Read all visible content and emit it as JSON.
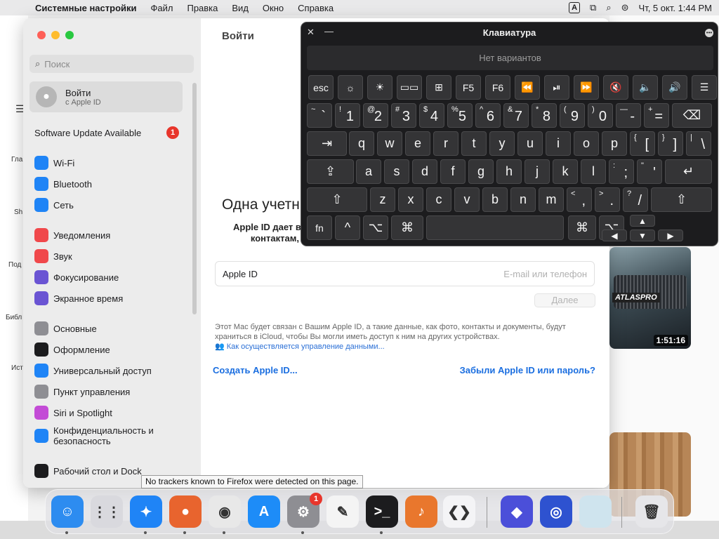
{
  "menubar": {
    "app_name": "Системные настройки",
    "items": [
      "Файл",
      "Правка",
      "Вид",
      "Окно",
      "Справка"
    ],
    "input_source": "A",
    "clock": "Чт, 5 окт.  1:44 PM"
  },
  "background": {
    "sidebar_texts": [
      "Гла",
      "Sh",
      "Под",
      "Библ",
      "Ист"
    ],
    "video_duration": "1:51:16",
    "video_plate": "ATLASPRO"
  },
  "settings": {
    "search_placeholder": "Поиск",
    "account_name": "Войти",
    "account_sub": "с Apple ID",
    "update_label": "Software Update Available",
    "update_count": "1",
    "items": [
      {
        "label": "Wi-Fi",
        "color": "#1f84f6",
        "icon": "wifi-icon"
      },
      {
        "label": "Bluetooth",
        "color": "#1f84f6",
        "icon": "bluetooth-icon"
      },
      {
        "label": "Сеть",
        "color": "#1f84f6",
        "icon": "globe-icon"
      },
      {
        "label": "Уведомления",
        "color": "#f0484b",
        "icon": "bell-icon"
      },
      {
        "label": "Звук",
        "color": "#f0484b",
        "icon": "speaker-icon"
      },
      {
        "label": "Фокусирование",
        "color": "#6a54d3",
        "icon": "moon-icon"
      },
      {
        "label": "Экранное время",
        "color": "#6a54d3",
        "icon": "hourglass-icon"
      },
      {
        "label": "Основные",
        "color": "#8e8e93",
        "icon": "gear-icon"
      },
      {
        "label": "Оформление",
        "color": "#1c1c1e",
        "icon": "appearance-icon"
      },
      {
        "label": "Универсальный доступ",
        "color": "#1f84f6",
        "icon": "accessibility-icon"
      },
      {
        "label": "Пункт управления",
        "color": "#8e8e93",
        "icon": "control-center-icon"
      },
      {
        "label": "Siri и Spotlight",
        "color": "#c34bd6",
        "icon": "siri-icon"
      },
      {
        "label": "Конфиденциальность и",
        "label2": "безопасность",
        "color": "#1f84f6",
        "icon": "hand-icon"
      },
      {
        "label": "Рабочий стол и Dock",
        "color": "#1c1c1e",
        "icon": "dock-icon"
      }
    ],
    "content": {
      "title": "Войти",
      "heading": "Одна учетн",
      "desc_line1": "Apple ID дает в",
      "desc_line2": "контактам,",
      "field_label": "Apple ID",
      "field_placeholder": "E-mail или телефон",
      "next_button": "Далее",
      "info_text": "Этот Mac будет связан с Вашим Apple ID, а такие данные, как фото, контакты и документы, будут храниться в iCloud, чтобы Вы могли иметь доступ к ним на других устройствах.",
      "info_link": "Как осуществляется управление данными...",
      "create_link": "Создать Apple ID...",
      "forgot_link": "Забыли Apple ID или пароль?"
    }
  },
  "tooltip": "No trackers known to Firefox were detected on this page.",
  "keyboard": {
    "title": "Клавиатура",
    "suggestions": "Нет вариантов",
    "fn_row": [
      "esc",
      "☼",
      "☀",
      "▭▭",
      "⊞",
      "F5",
      "F6",
      "⏪",
      "⏯",
      "⏩",
      "🔇",
      "🔈",
      "🔊",
      "☰"
    ],
    "num_row": [
      {
        "top": "~",
        "main": "`"
      },
      {
        "top": "!",
        "main": "1"
      },
      {
        "top": "@",
        "main": "2"
      },
      {
        "top": "#",
        "main": "3"
      },
      {
        "top": "$",
        "main": "4"
      },
      {
        "top": "%",
        "main": "5"
      },
      {
        "top": "^",
        "main": "6"
      },
      {
        "top": "&",
        "main": "7"
      },
      {
        "top": "*",
        "main": "8"
      },
      {
        "top": "(",
        "main": "9"
      },
      {
        "top": ")",
        "main": "0"
      },
      {
        "top": "—",
        "main": "-"
      },
      {
        "top": "+",
        "main": "="
      }
    ],
    "row_q": [
      "q",
      "w",
      "e",
      "r",
      "t",
      "y",
      "u",
      "i",
      "o",
      "p"
    ],
    "row_q_extra": [
      {
        "top": "{",
        "main": "["
      },
      {
        "top": "}",
        "main": "]"
      },
      {
        "top": "|",
        "main": "\\"
      }
    ],
    "row_a": [
      "a",
      "s",
      "d",
      "f",
      "g",
      "h",
      "j",
      "k",
      "l"
    ],
    "row_a_extra": [
      {
        "top": ":",
        "main": ";"
      },
      {
        "top": "\"",
        "main": "'"
      }
    ],
    "row_z": [
      "z",
      "x",
      "c",
      "v",
      "b",
      "n",
      "m"
    ],
    "row_z_extra": [
      {
        "top": "<",
        "main": ","
      },
      {
        "top": ">",
        "main": "."
      },
      {
        "top": "?",
        "main": "/"
      }
    ],
    "tab": "⇥",
    "backspace": "⌫",
    "caps": "⇪",
    "enter": "↵",
    "shift": "⇧",
    "fn": "fn",
    "ctrl": "^",
    "opt": "⌥",
    "cmd": "⌘",
    "arrows": {
      "up": "▲",
      "left": "◀",
      "down": "▼",
      "right": "▶"
    }
  },
  "dock": [
    {
      "name": "finder",
      "label": "☺",
      "color": "#2d8cf0"
    },
    {
      "name": "launchpad",
      "label": "⋮⋮",
      "color": "#d9d9de"
    },
    {
      "name": "safari",
      "label": "✦",
      "color": "#1f84f6"
    },
    {
      "name": "firefox",
      "label": "●",
      "color": "#e8642e"
    },
    {
      "name": "chrome",
      "label": "◉",
      "color": "#e8e8e8"
    },
    {
      "name": "app-store",
      "label": "A",
      "color": "#1d8cf8"
    },
    {
      "name": "system-settings",
      "label": "⚙",
      "color": "#8e8e93",
      "badge": "1"
    },
    {
      "name": "textedit",
      "label": "✎",
      "color": "#f4f4f4"
    },
    {
      "name": "terminal",
      "label": ">_",
      "color": "#1c1c1e"
    },
    {
      "name": "garageband",
      "label": "♪",
      "color": "#e9772d"
    },
    {
      "name": "vscode",
      "label": "❮❯",
      "color": "#f4f4f6"
    },
    {
      "name": "app-crystal",
      "label": "◆",
      "color": "#4b4fd9"
    },
    {
      "name": "app-square",
      "label": "◎",
      "color": "#2e52d0"
    },
    {
      "name": "app-blank",
      "label": "",
      "color": "#cfe4ee"
    },
    {
      "name": "trash",
      "label": "🗑",
      "color": "#e6e6e9"
    }
  ]
}
